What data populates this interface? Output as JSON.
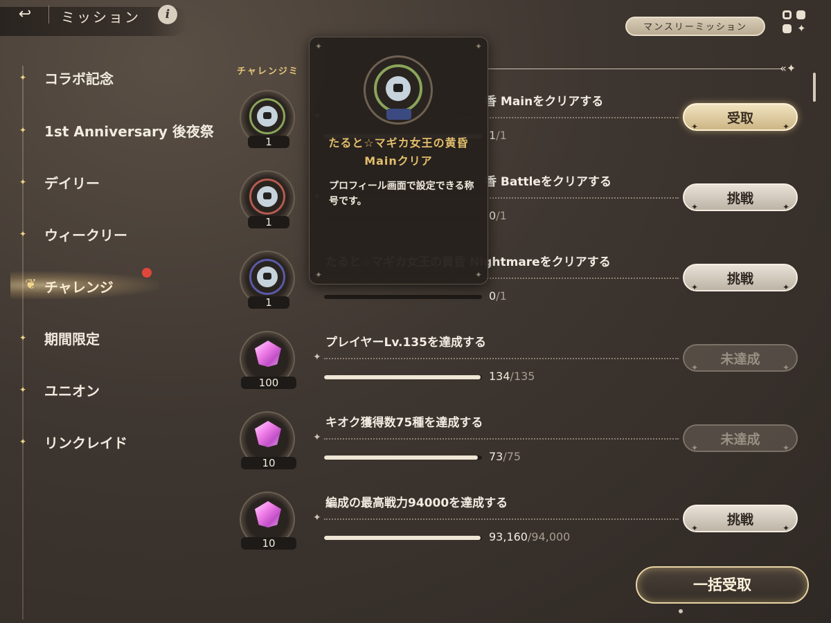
{
  "header": {
    "back_icon": "back-arrow-icon",
    "title": "ミッション",
    "info_label": "i",
    "monthly_button": "マンスリーミッション",
    "menu_icon": "grid-menu-icon"
  },
  "sidebar": {
    "items": [
      {
        "label": "コラボ記念",
        "active": false
      },
      {
        "label": "1st Anniversary 後夜祭",
        "active": false
      },
      {
        "label": "デイリー",
        "active": false
      },
      {
        "label": "ウィークリー",
        "active": false
      },
      {
        "label": "チャレンジ",
        "active": true,
        "notification": true
      },
      {
        "label": "期間限定",
        "active": false
      },
      {
        "label": "ユニオン",
        "active": false
      },
      {
        "label": "リンクレイド",
        "active": false
      }
    ]
  },
  "section": {
    "title_visible": "チャレンジミ"
  },
  "missions": [
    {
      "title_visible": "香 Mainをクリアする",
      "reward_count": "1",
      "progress_current": "1",
      "progress_total": "/1",
      "progress_fraction": 1.0,
      "button": "受取",
      "button_state": "claim"
    },
    {
      "title_visible": "香 Battleをクリアする",
      "reward_count": "1",
      "progress_current": "0",
      "progress_total": "/1",
      "progress_fraction": 0.0,
      "button": "挑戦",
      "button_state": "challenge"
    },
    {
      "title_visible": "たると☆マギカ女王の黄昏 Nightmareをクリアする",
      "reward_count": "1",
      "progress_current": "0",
      "progress_total": "/1",
      "progress_fraction": 0.0,
      "button": "挑戦",
      "button_state": "challenge"
    },
    {
      "title_visible": "プレイヤーLv.135を達成する",
      "reward_count": "100",
      "progress_current": "134",
      "progress_total": "/135",
      "progress_fraction": 0.993,
      "button": "未達成",
      "button_state": "locked"
    },
    {
      "title_visible": "キオク獲得数75種を達成する",
      "reward_count": "10",
      "progress_current": "73",
      "progress_total": "/75",
      "progress_fraction": 0.973,
      "button": "未達成",
      "button_state": "locked"
    },
    {
      "title_visible": "編成の最高戦力94000を達成する",
      "reward_count": "10",
      "progress_current": "93,160",
      "progress_total": "/94,000",
      "progress_fraction": 0.991,
      "button": "挑戦",
      "button_state": "challenge"
    }
  ],
  "tooltip": {
    "name": "たると☆マギカ女王の黄昏Mainクリア",
    "description": "プロフィール画面で設定できる称号です。"
  },
  "bulk_claim_button": "一括受取",
  "colors": {
    "accent_gold": "#e3bf6c",
    "notification": "#e0473b",
    "background": "#3e3630"
  }
}
